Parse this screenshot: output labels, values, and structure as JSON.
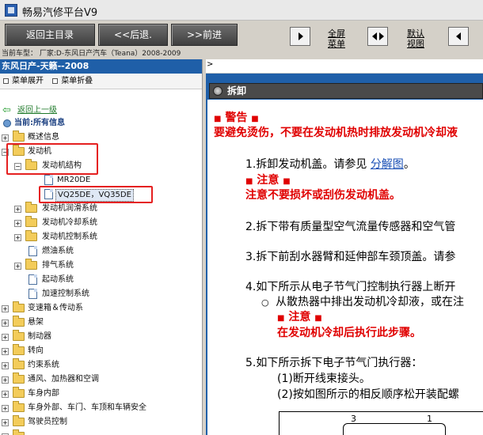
{
  "window": {
    "title": "畅易汽修平台V9"
  },
  "toolbar": {
    "back_home": "返回主目录",
    "back": "<<后退.",
    "forward": ">>前进",
    "fullscreen": "全屏菜单",
    "default_view": "默认视图"
  },
  "vehicle_line": "当前车型：  厂家:D-东风日产汽车（Teana）2008-2009",
  "left": {
    "header": "东风日产-天籁--2008",
    "expand_all": "菜单展开",
    "collapse_all": "菜单折叠",
    "go_up": "返回上一级",
    "current": "当前:所有信息",
    "tree": [
      {
        "label": "概述信息"
      },
      {
        "label": "发动机"
      },
      {
        "label": "发动机结构"
      },
      {
        "label": "MR20DE"
      },
      {
        "label": "VQ25DE，VQ35DE"
      },
      {
        "label": "发动机润滑系统"
      },
      {
        "label": "发动机冷却系统"
      },
      {
        "label": "发动机控制系统"
      },
      {
        "label": "燃油系统"
      },
      {
        "label": "排气系统"
      },
      {
        "label": "起动系统"
      },
      {
        "label": "加速控制系统"
      },
      {
        "label": "变速箱＆传动系"
      },
      {
        "label": "悬架"
      },
      {
        "label": "制动器"
      },
      {
        "label": "转向"
      },
      {
        "label": "约束系统"
      },
      {
        "label": "通风、加热器和空调"
      },
      {
        "label": "车身内部"
      },
      {
        "label": "车身外部、车门、车顶和车辆安全"
      },
      {
        "label": "驾驶员控制"
      }
    ]
  },
  "right": {
    "marker": ">",
    "section_title": "拆卸",
    "warning_title": "警告",
    "warning_text": "要避免烫伤，不要在发动机热时排放发动机冷却液",
    "step1_text": "1.拆卸发动机盖。请参见 ",
    "step1_link": "分解图",
    "step1_end": "。",
    "caution_title": "注意",
    "caution1_text": "注意不要损坏或刮伤发动机盖。",
    "step2": "2.拆下带有质量型空气流量传感器和空气管",
    "step3": "3.拆下前刮水器臂和延伸部车颈顶盖。请参",
    "step4": "4.如下所示从电子节气门控制执行器上断开",
    "step4_bullet": "从散热器中排出发动机冷却液，或在注",
    "caution2_title": "注意",
    "caution2_text": "在发动机冷却后执行此步骤。",
    "step5": "5.如下所示拆下电子节气门执行器：",
    "step5_a": "(1)断开线束接头。",
    "step5_b": "(2)按如图所示的相反顺序松开装配螺",
    "fig_num_3": "3",
    "fig_num_1": "1"
  }
}
